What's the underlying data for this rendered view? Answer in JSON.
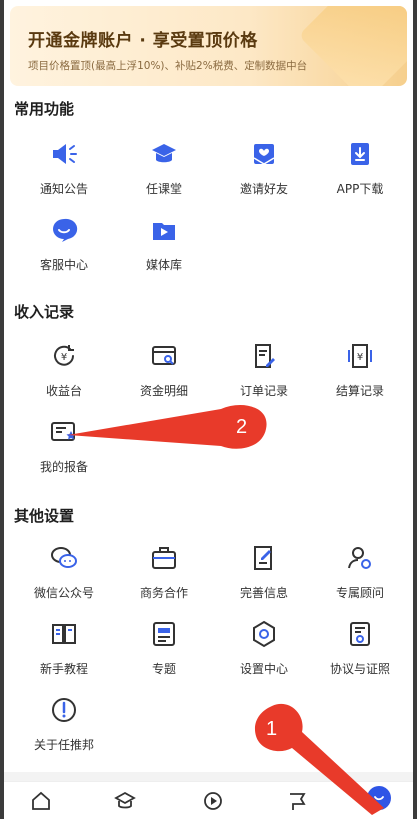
{
  "banner": {
    "title": "开通金牌账户 · 享受置顶价格",
    "subtitle": "项目价格置顶(最高上浮10%)、补贴2%税费、定制数据中台"
  },
  "sections": {
    "common": {
      "title": "常用功能",
      "items": [
        {
          "label": "通知公告",
          "icon": "megaphone-icon"
        },
        {
          "label": "任课堂",
          "icon": "graduation-cap-icon"
        },
        {
          "label": "邀请好友",
          "icon": "invite-envelope-icon"
        },
        {
          "label": "APP下载",
          "icon": "download-icon"
        },
        {
          "label": "客服中心",
          "icon": "chat-smile-icon"
        },
        {
          "label": "媒体库",
          "icon": "media-folder-icon"
        }
      ]
    },
    "income": {
      "title": "收入记录",
      "items": [
        {
          "label": "收益台",
          "icon": "yuan-refresh-icon"
        },
        {
          "label": "资金明细",
          "icon": "card-search-icon"
        },
        {
          "label": "订单记录",
          "icon": "document-edit-icon"
        },
        {
          "label": "结算记录",
          "icon": "yuan-receipt-icon"
        },
        {
          "label": "我的报备",
          "icon": "report-star-icon"
        }
      ]
    },
    "other": {
      "title": "其他设置",
      "items": [
        {
          "label": "微信公众号",
          "icon": "wechat-icon"
        },
        {
          "label": "商务合作",
          "icon": "briefcase-icon"
        },
        {
          "label": "完善信息",
          "icon": "edit-info-icon"
        },
        {
          "label": "专属顾问",
          "icon": "consultant-icon"
        },
        {
          "label": "新手教程",
          "icon": "book-icon"
        },
        {
          "label": "专题",
          "icon": "topic-icon"
        },
        {
          "label": "设置中心",
          "icon": "settings-hex-icon"
        },
        {
          "label": "协议与证照",
          "icon": "certificate-icon"
        },
        {
          "label": "关于任推邦",
          "icon": "info-icon"
        }
      ]
    }
  },
  "annotations": {
    "marker_1": "1",
    "marker_2": "2",
    "arrow_color": "#e83a2a"
  },
  "tabbar": {
    "tabs": [
      "home-icon",
      "course-icon",
      "play-icon",
      "flag-icon",
      "profile-icon"
    ],
    "accent": "#2f55e6"
  },
  "colors": {
    "icon_blue": "#3a63e8"
  }
}
